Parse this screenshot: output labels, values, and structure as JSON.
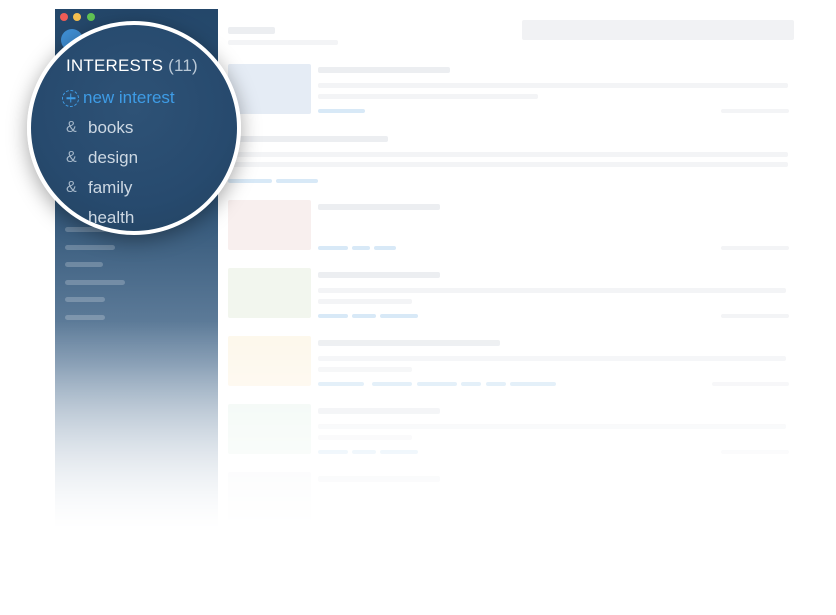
{
  "sidebar": {
    "section_title": "INTERESTS",
    "section_count": "(11)",
    "new_item_label": "new interest",
    "items": [
      {
        "label": "books",
        "icon": "ampersand-icon"
      },
      {
        "label": "design",
        "icon": "ampersand-icon"
      },
      {
        "label": "family",
        "icon": "ampersand-icon"
      },
      {
        "label": "health",
        "icon": "ampersand-icon"
      }
    ],
    "item_glyph": "&"
  },
  "window": {
    "traffic_lights": [
      "#ee5c56",
      "#f4bf4f",
      "#61c454"
    ]
  },
  "colors": {
    "sidebar": "#24476a",
    "accent": "#3e9ce6",
    "item_text": "#cdd8e3"
  }
}
